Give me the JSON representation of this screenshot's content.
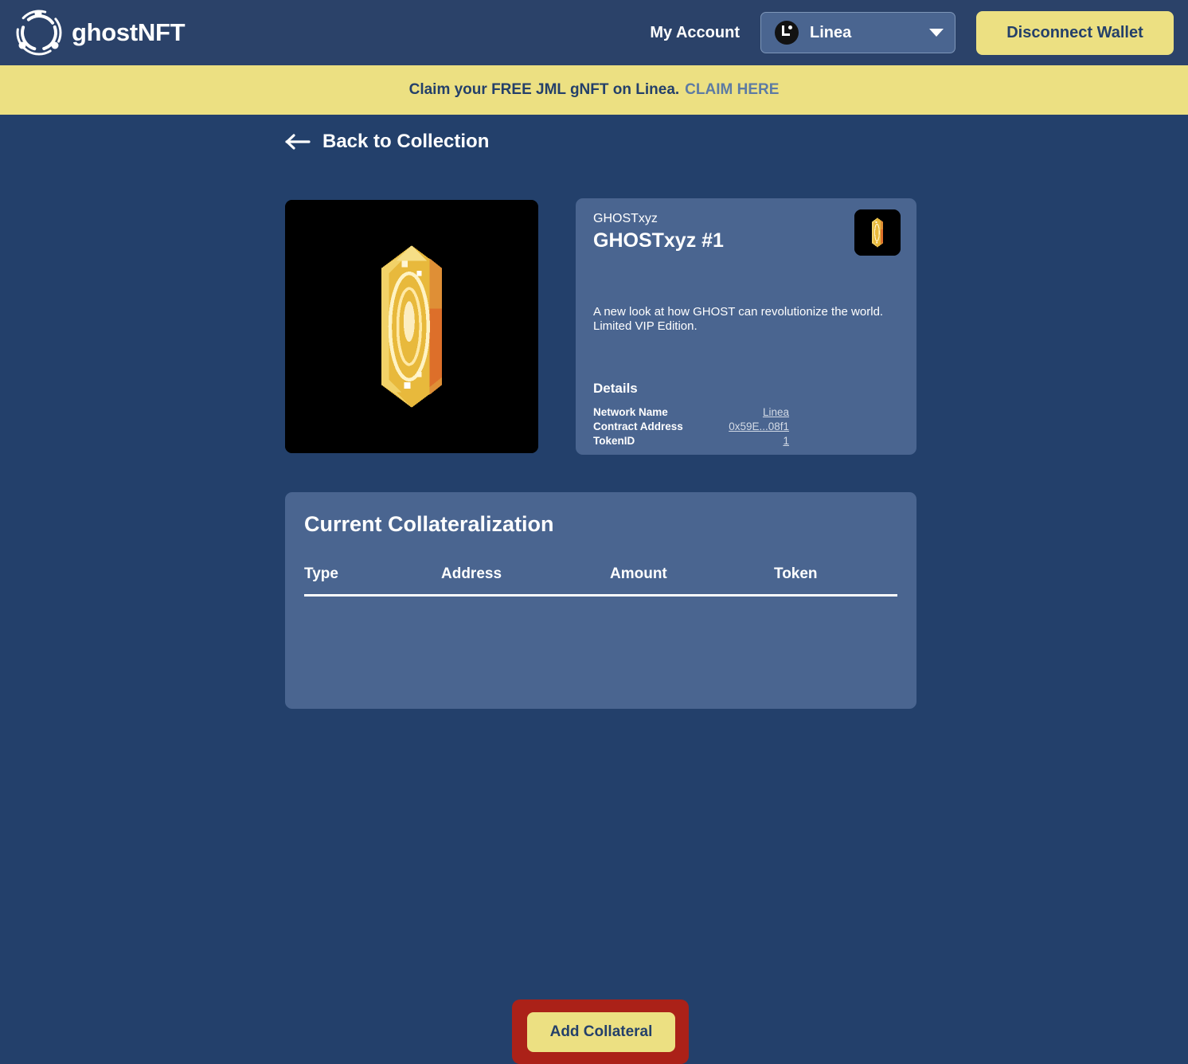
{
  "header": {
    "brand_name": "ghostNFT",
    "brand_logo_icon": "ghost-orbit-logo-icon",
    "my_account_label": "My Account",
    "network": {
      "name": "Linea",
      "logo_icon": "linea-logo-icon",
      "caret_icon": "chevron-down-icon"
    },
    "disconnect_label": "Disconnect Wallet"
  },
  "banner": {
    "text": "Claim your FREE JML gNFT on Linea.",
    "link_label": "CLAIM HERE"
  },
  "back_link": {
    "label": "Back to Collection",
    "icon": "arrow-left-icon"
  },
  "nft": {
    "art_icon": "golden-crystal-pixel-art",
    "thumb_icon": "golden-crystal-pixel-art-thumbnail",
    "collection_name": "GHOSTxyz",
    "title": "GHOSTxyz #1",
    "description": "A new look at how GHOST can revolutionize the world. Limited VIP Edition.",
    "details_title": "Details",
    "details": [
      {
        "key": "Network Name",
        "value": "Linea"
      },
      {
        "key": "Contract Address",
        "value": "0x59E...08f1"
      },
      {
        "key": "TokenID",
        "value": "1"
      }
    ]
  },
  "collateralization": {
    "title": "Current Collateralization",
    "columns": [
      "Type",
      "Address",
      "Amount",
      "Token"
    ],
    "rows": [],
    "add_button_label": "Add Collateral"
  },
  "colors": {
    "page_background": "#23406b",
    "header_background": "#2b4269",
    "card_background": "#4a6590",
    "accent_yellow": "#ece082",
    "highlight_red": "#ab2118",
    "text_primary": "#ffffff",
    "text_on_yellow": "#24406a",
    "banner_link": "#5d7ba3"
  }
}
